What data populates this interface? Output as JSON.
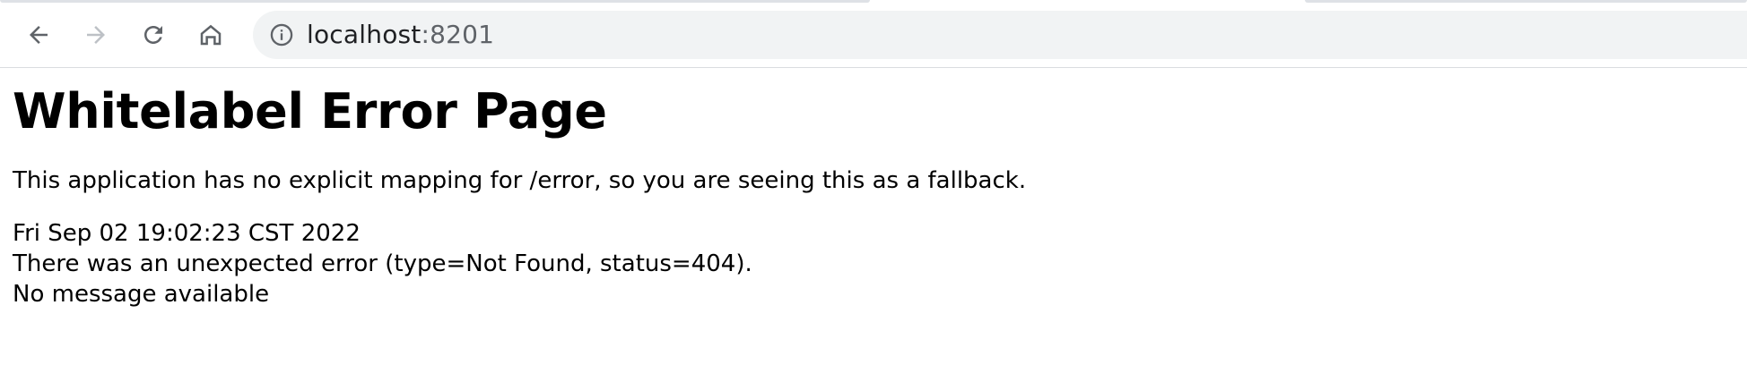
{
  "browser": {
    "nav": {
      "back_icon": "arrow-left-icon",
      "forward_icon": "arrow-right-icon",
      "reload_icon": "reload-icon",
      "home_icon": "home-icon"
    },
    "address_bar": {
      "info_icon": "info-circle-icon",
      "host": "localhost",
      "port": ":8201"
    },
    "colors": {
      "omnibox_bg": "#f1f3f4",
      "icon": "#5f6368",
      "icon_disabled": "#bdc1c6"
    }
  },
  "page": {
    "title": "Whitelabel Error Page",
    "explanation": "This application has no explicit mapping for /error, so you are seeing this as a fallback.",
    "timestamp": "Fri Sep 02 19:02:23 CST 2022",
    "error_line": "There was an unexpected error (type=Not Found, status=404).",
    "message": "No message available"
  }
}
